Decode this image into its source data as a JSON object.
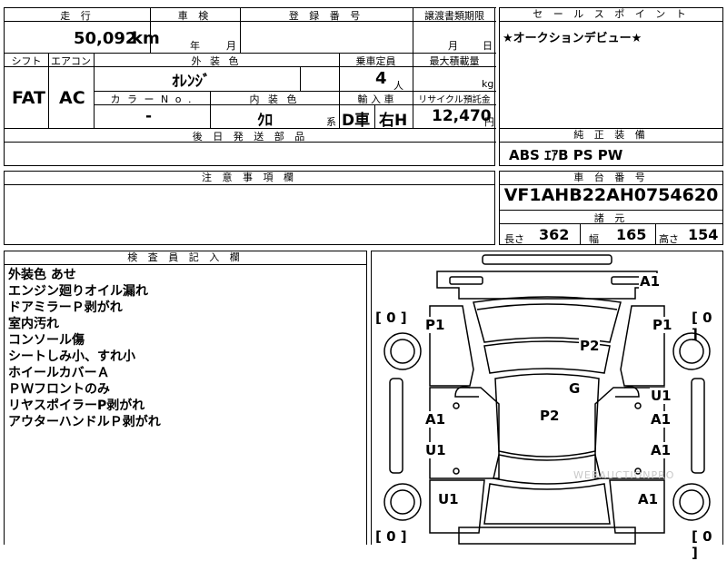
{
  "mileage": {
    "label": "走 行",
    "value": "50,092",
    "unit": "km"
  },
  "inspection": {
    "label": "車 検",
    "year_unit": "年",
    "month_unit": "月"
  },
  "registration": {
    "label": "登 録 番 号",
    "value": ""
  },
  "transfer_deadline": {
    "label": "譲渡書類期限",
    "month_unit": "月",
    "day_unit": "日"
  },
  "shift": {
    "label": "シフト",
    "value": "FAT"
  },
  "aircon": {
    "label": "エアコン",
    "value": "AC"
  },
  "exterior_color": {
    "label": "外 装 色",
    "value": "ｵﾚﾝｼﾞ"
  },
  "capacity": {
    "label": "乗車定員",
    "value": "4",
    "unit": "人"
  },
  "max_load": {
    "label": "最大積載量",
    "value": "",
    "unit": "kg"
  },
  "color_no": {
    "label": "カ ラ ー N o .",
    "value": "-"
  },
  "interior_color": {
    "label": "内 装 色",
    "value": "ｸﾛ",
    "suffix": "系"
  },
  "import": {
    "label": "輸 入 車",
    "dealer": "D車",
    "steering": "右H"
  },
  "recycle": {
    "label": "リサイクル預託金",
    "value": "12,470",
    "unit": "円"
  },
  "later_parts": {
    "label": "後 日 発 送 部 品",
    "value": ""
  },
  "selling_point": {
    "label": "セ ー ル ス ポ イ ン ト",
    "value": "★オークションデビュー★"
  },
  "equipment": {
    "label": "純 正 装 備",
    "value": "ABS ｴｱB PS PW"
  },
  "caution": {
    "label": "注 意 事 項 欄",
    "value": ""
  },
  "chassis": {
    "label": "車 台 番 号",
    "value": "VF1AHB22AH0754620"
  },
  "specs": {
    "label": "諸 元",
    "length_label": "長さ",
    "length": "362",
    "width_label": "幅",
    "width": "165",
    "height_label": "高さ",
    "height": "154"
  },
  "inspector": {
    "label": "検 査 員 記 入 欄",
    "notes": [
      "外装色 あせ",
      "エンジン廻りオイル漏れ",
      "ドアミラーＰ剥がれ",
      "室内汚れ",
      "コンソール傷",
      "シートしみ小、すれ小",
      "ホイールカバーＡ",
      "ＰＷフロントのみ",
      "リヤスポイラーP剥がれ",
      "アウターハンドルＰ剥がれ"
    ]
  },
  "diagram": {
    "tires": [
      "[ 0 ]",
      "[ 0 ]",
      "[ 0 ]",
      "[ 0 ]"
    ],
    "marks": [
      "A1",
      "P1",
      "P1",
      "P2",
      "G",
      "U1",
      "A1",
      "P2",
      "A1",
      "U1",
      "A1",
      "U1",
      "A1",
      "U1"
    ],
    "watermark": "WEBAUCTIONPRO"
  }
}
